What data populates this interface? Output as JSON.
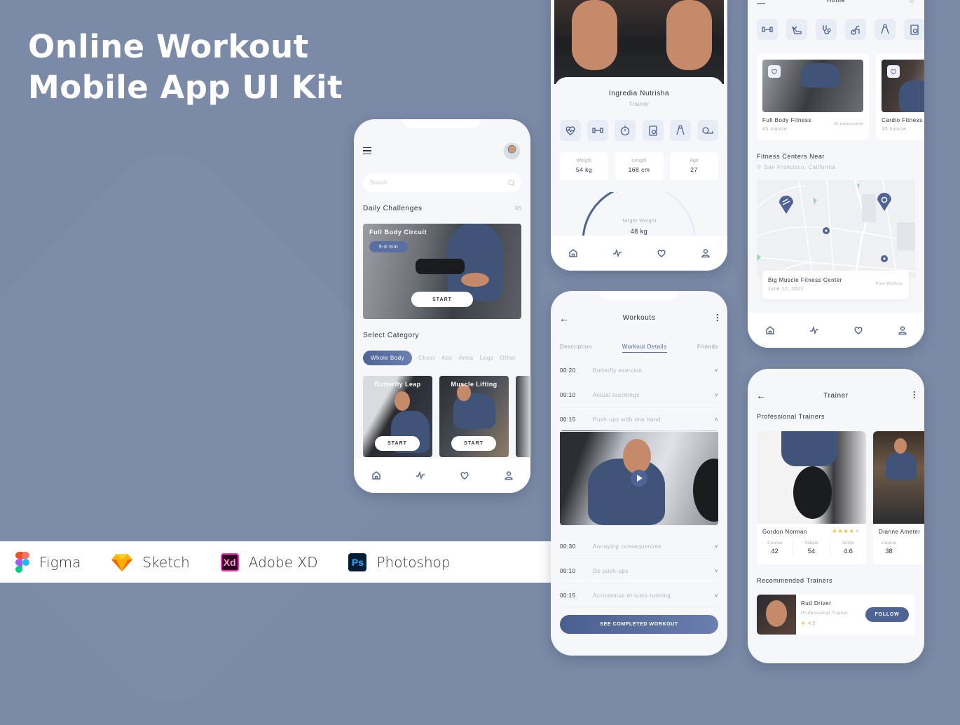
{
  "hero": {
    "line1": "Online Workout",
    "line2": "Mobile App UI Kit"
  },
  "colors": {
    "background": "#7b8aa6",
    "accent": "#4f6394",
    "surface": "#f5f7fa"
  },
  "tools": [
    {
      "icon": "figma-icon",
      "label": "Figma"
    },
    {
      "icon": "sketch-icon",
      "label": "Sketch"
    },
    {
      "icon": "adobe-xd-icon",
      "label": "Adobe XD",
      "glyph": "Xd"
    },
    {
      "icon": "photoshop-icon",
      "label": "Photoshop",
      "glyph": "Ps"
    }
  ],
  "phone1": {
    "search_placeholder": "Search",
    "daily": {
      "title": "Daily Challenges",
      "count": "3/5"
    },
    "challenge": {
      "title": "Full Body Circuit",
      "duration": "5-8 min",
      "start": "START"
    },
    "category_title": "Select Category",
    "categories": [
      "Whole Body",
      "Chest",
      "Abs",
      "Arms",
      "Legs",
      "Other"
    ],
    "cards": [
      {
        "title": "Butterfly Leap",
        "start": "START"
      },
      {
        "title": "Muscle Lifting",
        "start": "START"
      }
    ]
  },
  "phone2": {
    "name": "Ingredia Nutrisha",
    "role": "Trainer",
    "stats": [
      {
        "label": "Weight",
        "value": "54 kg"
      },
      {
        "label": "Length",
        "value": "168 cm"
      },
      {
        "label": "Age",
        "value": "27"
      }
    ],
    "target": {
      "label": "Target Weight",
      "value": "48 kg",
      "progress": 0.5
    }
  },
  "phone3": {
    "title": "Workouts",
    "tabs": [
      "Description",
      "Workout Details",
      "Friends"
    ],
    "active_tab": "Workout Details",
    "items": [
      {
        "time": "00:20",
        "name": "Butterfly exercise",
        "expanded": false
      },
      {
        "time": "00:10",
        "name": "Actual teachings",
        "expanded": false
      },
      {
        "time": "00:15",
        "name": "Push-ups with one hand",
        "expanded": true
      },
      {
        "time": "00:30",
        "name": "Annoying consequences",
        "expanded": false
      },
      {
        "time": "00:10",
        "name": "Do push-ups",
        "expanded": false
      },
      {
        "time": "00:15",
        "name": "Accusamus et iusto running",
        "expanded": false
      }
    ],
    "cta": "SEE COMPLETED WORKOUT"
  },
  "phone4": {
    "title": "Home",
    "programs": [
      {
        "title": "Full Body Fitness",
        "duration": "45 minute",
        "participants": "30 participants"
      },
      {
        "title": "Cardio Fitness",
        "duration": "30 minute"
      }
    ],
    "near_title": "Fitness Centers Near",
    "location": "San Francisco, California",
    "center": {
      "name": "Big Muscle Fitness Center",
      "date": "June 17, 2021",
      "tag": "Free Workout"
    }
  },
  "phone5": {
    "title": "Trainer",
    "section1": "Professional Trainers",
    "trainers": [
      {
        "name": "Gordon Norman",
        "rating": 4,
        "stats": [
          {
            "label": "Course",
            "value": "42"
          },
          {
            "label": "Videos",
            "value": "54"
          },
          {
            "label": "Score",
            "value": "4.6"
          }
        ]
      },
      {
        "name": "Dianne Ameter",
        "stats": [
          {
            "label": "Course",
            "value": "38"
          }
        ]
      }
    ],
    "section2": "Recommended Trainers",
    "recommended": {
      "name": "Rud Driver",
      "role": "Professional Trainer",
      "rating": "4.9",
      "follow": "FOLLOW"
    }
  }
}
